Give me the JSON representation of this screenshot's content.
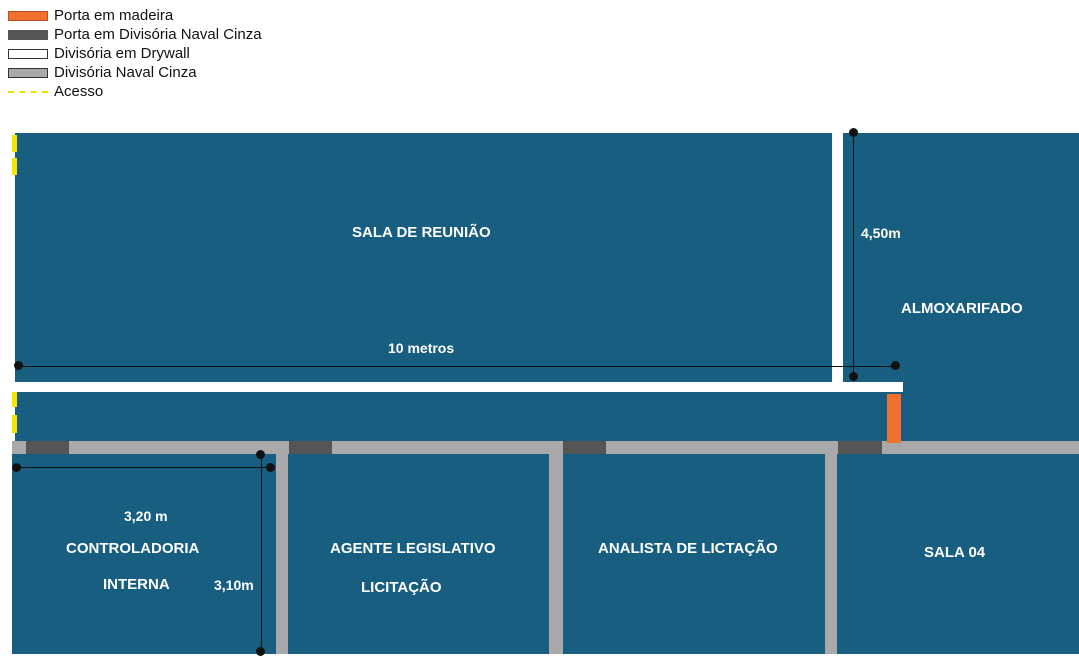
{
  "legend": {
    "wood_door": "Porta em madeira",
    "naval_door": "Porta em Divisória Naval Cinza",
    "drywall": "Divisória em Drywall",
    "naval_partition": "Divisória Naval Cinza",
    "access": "Acesso"
  },
  "rooms": {
    "meeting": "SALA DE REUNIÃO",
    "storage": "ALMOXARIFADO",
    "controladoria_line1": "CONTROLADORIA",
    "controladoria_line2": "INTERNA",
    "agente_line1": "AGENTE LEGISLATIVO",
    "agente_line2": "LICITAÇÃO",
    "analista": "ANALISTA DE LICTAÇÃO",
    "sala04": "SALA 04"
  },
  "dimensions": {
    "meeting_width": "10 metros",
    "storage_height": "4,50m",
    "controladoria_width": "3,20  m",
    "controladoria_height": "3,10m"
  },
  "colors": {
    "room_fill": "#175e80",
    "wood_door": "#f07030",
    "naval_door": "#555555",
    "naval_partition": "#a9a9a9",
    "drywall": "#ffffff",
    "access": "#f5e800"
  }
}
